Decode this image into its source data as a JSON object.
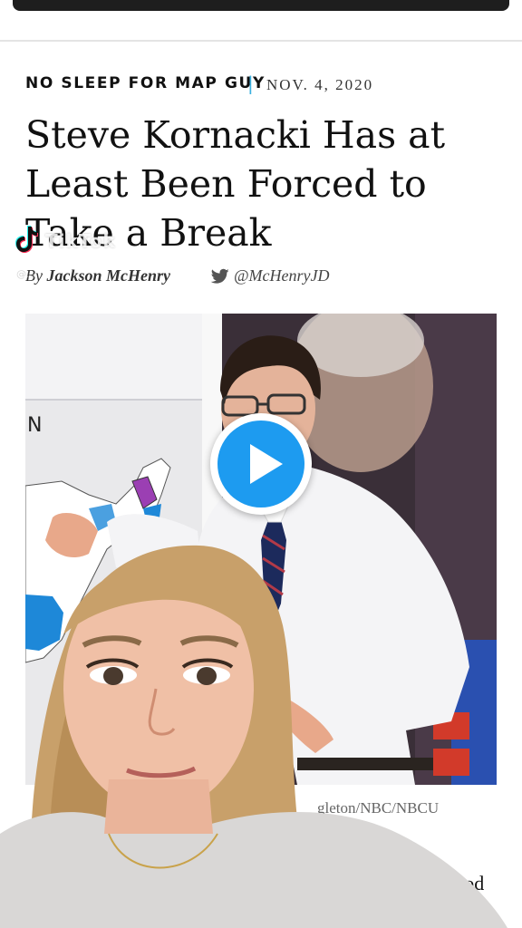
{
  "article": {
    "kicker": "NO SLEEP FOR MAP GUY",
    "kicker_separator": "|",
    "date": "NOV. 4, 2020",
    "headline": "Steve Kornacki Has at Least Been Forced to Take a Break",
    "byline_prefix": "By",
    "author": "Jackson McHenry",
    "twitter_handle": "@McHenryJD",
    "photo_caption": "gleton/NBC/NBCU",
    "body_fragment": "period"
  },
  "overlay": {
    "app_watermark": "TikTok",
    "watermark_user": "@..."
  },
  "icons": {
    "twitter": "twitter-bird-icon",
    "play": "play-icon",
    "tiktok": "tiktok-logo-icon"
  },
  "colors": {
    "accent_blue": "#3ab0e0",
    "play_blue": "#1d9bf0",
    "map_blue": "#1e88d8",
    "map_purple": "#9b3fb3"
  }
}
